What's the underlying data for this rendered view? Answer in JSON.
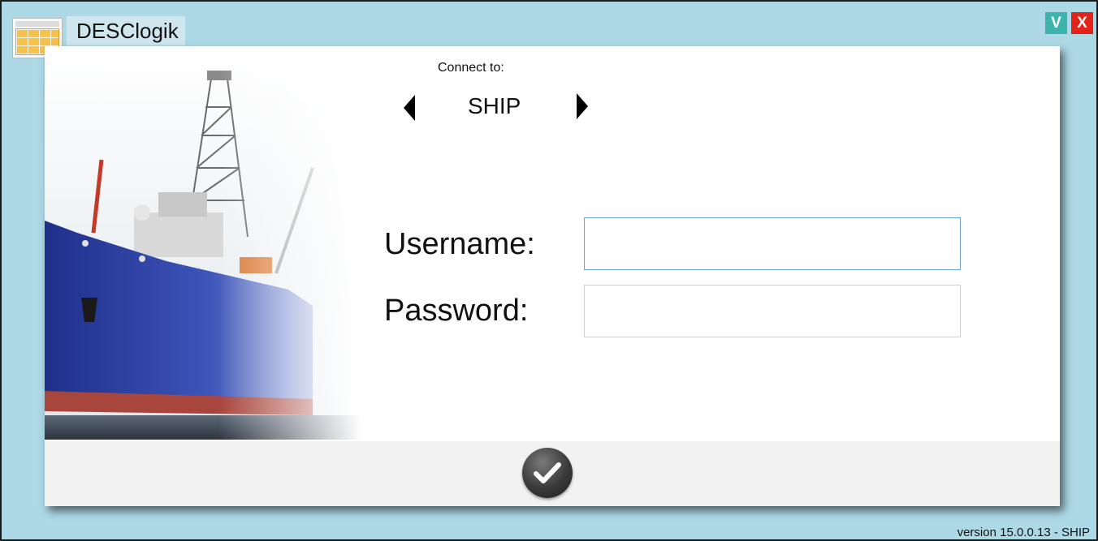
{
  "window": {
    "title": "DESClogik",
    "minimize_label": "V",
    "close_label": "X",
    "icons": {
      "app": "table-grid-icon",
      "ok": "checkmark-icon",
      "prev": "arrow-left-icon",
      "next": "arrow-right-icon"
    }
  },
  "connect": {
    "label": "Connect to:",
    "server": "SHIP"
  },
  "form": {
    "username_label": "Username:",
    "password_label": "Password:",
    "username_value": "",
    "password_value": ""
  },
  "footer": {
    "version": "version 15.0.0.13 - SHIP"
  },
  "colors": {
    "window_bg": "#add8e6",
    "minimize_btn": "#3cb4ad",
    "close_btn": "#e2231a",
    "footer_bg": "#f2f2f2"
  }
}
